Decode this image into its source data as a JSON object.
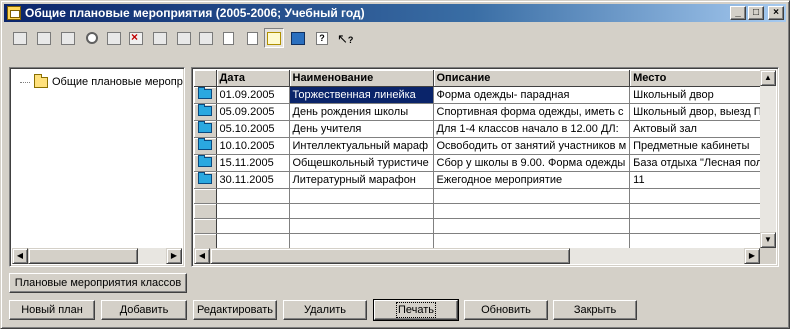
{
  "window": {
    "title": "Общие плановые мероприятия (2005-2006; Учебный год)",
    "controls": {
      "minimize": "_",
      "maximize": "□",
      "close": "×"
    }
  },
  "toolbar": {
    "icons": [
      "calendar-icon",
      "folder-open-icon",
      "grid-icon",
      "find-icon",
      "list-edit-icon",
      "delete-icon",
      "copy-icon",
      "magic-wand-icon",
      "paste-icon",
      "document-icon",
      "document-lines-icon",
      "tree-view-icon",
      "computer-icon",
      "help-icon",
      "context-help-icon"
    ],
    "help_glyph": "?",
    "context_help_glyph": "?"
  },
  "tree": {
    "root_label": "Общие плановые меропр"
  },
  "grid": {
    "columns": [
      "Дата",
      "Наименование",
      "Описание",
      "Место"
    ],
    "rows": [
      [
        "01.09.2005",
        "Торжественная линейка",
        "Форма одежды- парадная",
        "Школьный двор"
      ],
      [
        "05.09.2005",
        "День рождения школы",
        "Спортивная форма одежды, иметь с",
        "Школьный двор, выезд П."
      ],
      [
        "05.10.2005",
        "День учителя",
        "Для 1-4 классов начало в 12.00  ДЛ:",
        "Актовый зал"
      ],
      [
        "10.10.2005",
        "Интеллектуальный мараф",
        "Освободить от занятий участников м",
        "Предметные кабинеты"
      ],
      [
        "15.11.2005",
        "Общешкольный туристиче",
        "Сбор у школы в 9.00. Форма одежды",
        "База отдыха \"Лесная пол"
      ],
      [
        "30.11.2005",
        "Литературный марафон",
        "Ежегодное мероприятие",
        "11"
      ]
    ],
    "empty_rows": 5,
    "selected_row": 0,
    "selected_col": 1
  },
  "buttons": {
    "class_events": "Плановые мероприятия классов",
    "new_plan": "Новый план",
    "add": "Добавить",
    "edit": "Редактировать",
    "delete": "Удалить",
    "print": "Печать",
    "refresh": "Обновить",
    "close": "Закрыть"
  },
  "colors": {
    "selection": "#0a246a",
    "title_bar": "#0a246a",
    "face": "#d4d0c8"
  }
}
